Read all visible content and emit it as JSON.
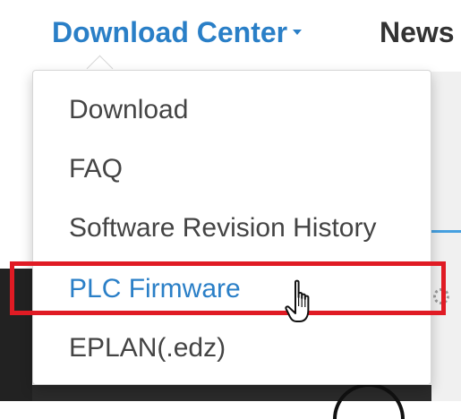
{
  "nav": {
    "download_center": "Download Center",
    "news": "News"
  },
  "dropdown": {
    "items": [
      {
        "label": "Download"
      },
      {
        "label": "FAQ"
      },
      {
        "label": "Software Revision History"
      },
      {
        "label": "PLC Firmware",
        "state": "hovered"
      },
      {
        "label": "EPLAN(.edz)"
      }
    ]
  },
  "colors": {
    "link_blue": "#2a7fc7",
    "highlight_red": "#e01b24",
    "menu_text": "#444444"
  },
  "icons": {
    "caret": "chevron-down-icon",
    "cursor": "hand-pointer-cursor-icon"
  }
}
